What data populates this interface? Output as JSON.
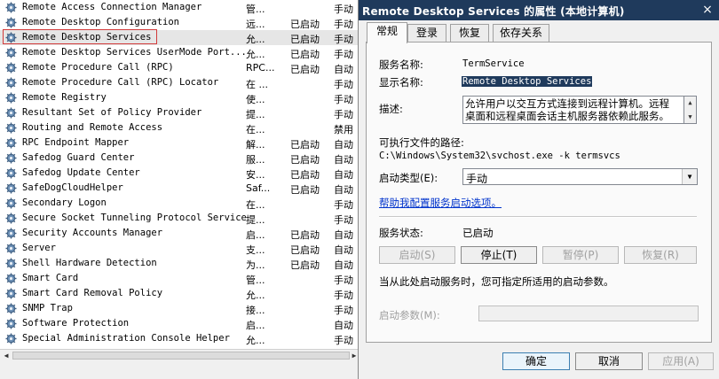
{
  "services": [
    {
      "name": "Remote Access Connection Manager",
      "desc": "管...",
      "status": "",
      "startup": "手动"
    },
    {
      "name": "Remote Desktop Configuration",
      "desc": "远...",
      "status": "已启动",
      "startup": "手动"
    },
    {
      "name": "Remote Desktop Services",
      "desc": "允...",
      "status": "已启动",
      "startup": "手动"
    },
    {
      "name": "Remote Desktop Services UserMode Port...",
      "desc": "允...",
      "status": "已启动",
      "startup": "手动"
    },
    {
      "name": "Remote Procedure Call (RPC)",
      "desc": "RPC...",
      "status": "已启动",
      "startup": "自动"
    },
    {
      "name": "Remote Procedure Call (RPC) Locator",
      "desc": "在 ...",
      "status": "",
      "startup": "手动"
    },
    {
      "name": "Remote Registry",
      "desc": "使...",
      "status": "",
      "startup": "手动"
    },
    {
      "name": "Resultant Set of Policy Provider",
      "desc": "提...",
      "status": "",
      "startup": "手动"
    },
    {
      "name": "Routing and Remote Access",
      "desc": "在...",
      "status": "",
      "startup": "禁用"
    },
    {
      "name": "RPC Endpoint Mapper",
      "desc": "解...",
      "status": "已启动",
      "startup": "自动"
    },
    {
      "name": "Safedog Guard Center",
      "desc": "服...",
      "status": "已启动",
      "startup": "自动"
    },
    {
      "name": "Safedog Update Center",
      "desc": "安...",
      "status": "已启动",
      "startup": "自动"
    },
    {
      "name": "SafeDogCloudHelper",
      "desc": "Saf...",
      "status": "已启动",
      "startup": "自动"
    },
    {
      "name": "Secondary Logon",
      "desc": "在...",
      "status": "",
      "startup": "手动"
    },
    {
      "name": "Secure Socket Tunneling Protocol Service",
      "desc": "提...",
      "status": "",
      "startup": "手动"
    },
    {
      "name": "Security Accounts Manager",
      "desc": "启...",
      "status": "已启动",
      "startup": "自动"
    },
    {
      "name": "Server",
      "desc": "支...",
      "status": "已启动",
      "startup": "自动"
    },
    {
      "name": "Shell Hardware Detection",
      "desc": "为...",
      "status": "已启动",
      "startup": "自动"
    },
    {
      "name": "Smart Card",
      "desc": "管...",
      "status": "",
      "startup": "手动"
    },
    {
      "name": "Smart Card Removal Policy",
      "desc": "允...",
      "status": "",
      "startup": "手动"
    },
    {
      "name": "SNMP Trap",
      "desc": "接...",
      "status": "",
      "startup": "手动"
    },
    {
      "name": "Software Protection",
      "desc": "启...",
      "status": "",
      "startup": "自动"
    },
    {
      "name": "Special Administration Console Helper",
      "desc": "允...",
      "status": "",
      "startup": "手动"
    }
  ],
  "selected_service": "Remote Desktop Services",
  "dialog": {
    "title": "Remote Desktop Services 的属性 (本地计算机)",
    "close_icon": "×",
    "tabs": [
      "常规",
      "登录",
      "恢复",
      "依存关系"
    ],
    "active_tab": "常规",
    "service_name_label": "服务名称:",
    "service_name": "TermService",
    "display_name_label": "显示名称:",
    "display_name": "Remote Desktop Services",
    "description_label": "描述:",
    "description": "允许用户以交互方式连接到远程计算机。远程桌面和远程桌面会话主机服务器依赖此服务。",
    "exe_path_label": "可执行文件的路径:",
    "exe_path": "C:\\Windows\\System32\\svchost.exe -k termsvcs",
    "startup_type_label": "启动类型(E):",
    "startup_type": "手动",
    "help_link": "帮助我配置服务启动选项。",
    "service_status_label": "服务状态:",
    "service_status": "已启动",
    "buttons": {
      "start": "启动(S)",
      "stop": "停止(T)",
      "pause": "暂停(P)",
      "resume": "恢复(R)"
    },
    "start_params_hint": "当从此处启动服务时，您可指定所适用的启动参数。",
    "start_params_label": "启动参数(M):",
    "ok": "确定",
    "cancel": "取消",
    "apply": "应用(A)"
  },
  "icons": {
    "service": "gear-icon"
  },
  "colors": {
    "titlebar": "#1f3a5c",
    "highlight_border": "#d23b3b",
    "link": "#0033cc"
  }
}
